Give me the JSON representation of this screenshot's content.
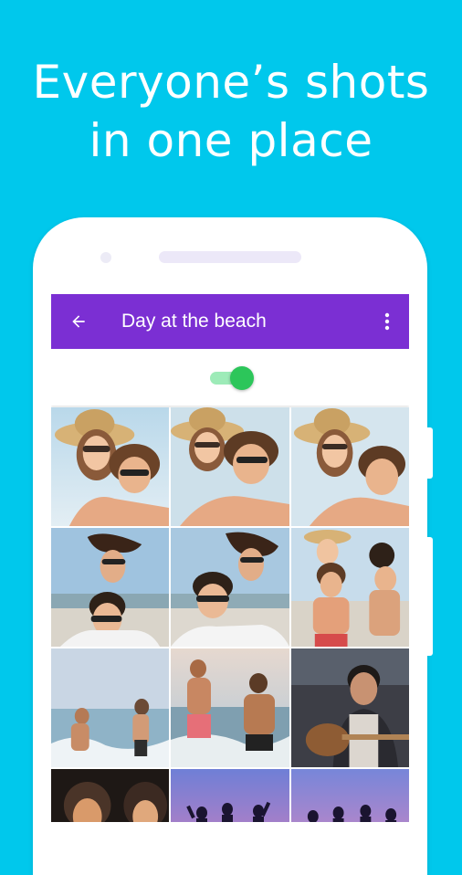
{
  "promo": {
    "headline_line1": "Everyone’s shots",
    "headline_line2": "in one place",
    "background_color": "#00C8EC"
  },
  "app": {
    "appbar_color": "#7B2FD3",
    "title": "Day at the beach",
    "back_icon": "arrow-back-icon",
    "menu_icon": "more-vert-icon",
    "sharing_toggle": {
      "on": true,
      "color": "#2CC65A"
    }
  },
  "photos": [
    {
      "id": "p1",
      "scene": "couple-hat-piggyback"
    },
    {
      "id": "p2",
      "scene": "couple-hat-piggyback"
    },
    {
      "id": "p3",
      "scene": "couple-hat-piggyback"
    },
    {
      "id": "p4",
      "scene": "couple-beach-laugh"
    },
    {
      "id": "p5",
      "scene": "couple-beach-laugh"
    },
    {
      "id": "p6",
      "scene": "friends-piggyback"
    },
    {
      "id": "p7",
      "scene": "friends-running-waves"
    },
    {
      "id": "p8",
      "scene": "friends-splashing"
    },
    {
      "id": "p9",
      "scene": "man-guitar"
    },
    {
      "id": "p10",
      "scene": "campfire-night"
    },
    {
      "id": "p11",
      "scene": "sunset-silhouettes"
    },
    {
      "id": "p12",
      "scene": "sunset-silhouettes"
    }
  ]
}
